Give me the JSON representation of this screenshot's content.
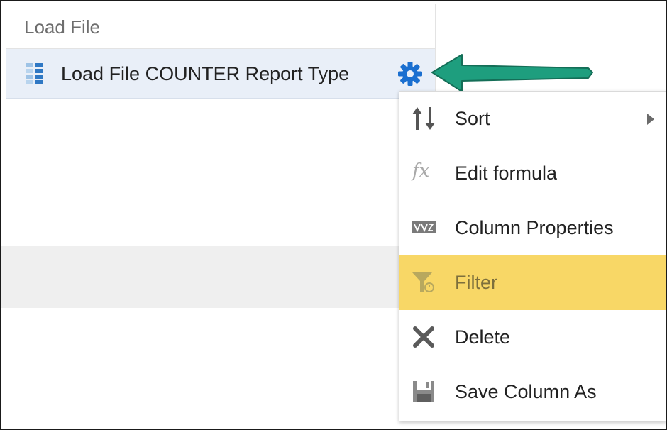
{
  "panel": {
    "header_label": "Load File",
    "column_label": "Load File COUNTER Report Type"
  },
  "colors": {
    "gear": "#1a6fd0",
    "arrow": "#1e9e7e",
    "highlight": "#f8d766",
    "selected_row": "#e9eff8"
  },
  "icons": {
    "column": "column-icon",
    "gear": "gear-icon",
    "arrow": "arrow-icon"
  },
  "menu": {
    "items": [
      {
        "label": "Sort",
        "icon": "sort-icon",
        "has_submenu": true
      },
      {
        "label": "Edit formula",
        "icon": "fx-icon"
      },
      {
        "label": "Column Properties",
        "icon": "column-properties-icon"
      },
      {
        "label": "Filter",
        "icon": "filter-icon",
        "highlighted": true
      },
      {
        "label": "Delete",
        "icon": "delete-icon"
      },
      {
        "label": "Save Column As",
        "icon": "save-icon"
      }
    ]
  }
}
